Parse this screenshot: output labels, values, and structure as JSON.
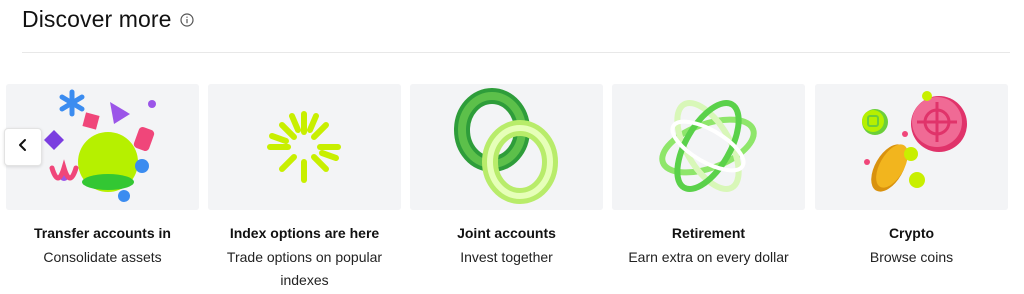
{
  "section": {
    "title": "Discover more"
  },
  "icons": {
    "info": "info-icon",
    "prev": "chevron-left-icon"
  },
  "cards": [
    {
      "title": "Transfer accounts in",
      "subtitle": "Consolidate assets",
      "illustration": "confetti-shapes"
    },
    {
      "title": "Index options are here",
      "subtitle": "Trade options on popular indexes",
      "illustration": "starburst"
    },
    {
      "title": "Joint accounts",
      "subtitle": "Invest together",
      "illustration": "linked-rings"
    },
    {
      "title": "Retirement",
      "subtitle": "Earn extra on every dollar",
      "illustration": "orbit-rings"
    },
    {
      "title": "Crypto",
      "subtitle": "Browse coins",
      "illustration": "coins"
    }
  ],
  "colors": {
    "card_bg": "#f3f4f6",
    "lime": "#b6f000",
    "green": "#3aa63a",
    "pink": "#f0467a",
    "purple": "#9b55e8",
    "blue": "#3b8cf0",
    "gold": "#f2b51e"
  }
}
